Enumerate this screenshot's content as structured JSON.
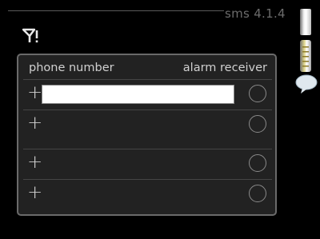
{
  "menu": {
    "label": "sms 4.1.4"
  },
  "icons": {
    "signal": "antenna-signal-icon",
    "chat": "speech-bubble-icon"
  },
  "table": {
    "headers": {
      "phone": "phone number",
      "alarm": "alarm receiver"
    },
    "rows": [
      {
        "plus": "+",
        "value": "",
        "has_input": true,
        "alarm_selected": false
      },
      {
        "plus": "+",
        "value": "",
        "has_input": false,
        "alarm_selected": false
      },
      {
        "plus": "+",
        "value": "",
        "has_input": false,
        "alarm_selected": false
      },
      {
        "plus": "+",
        "value": "",
        "has_input": false,
        "alarm_selected": false
      }
    ]
  },
  "colors": {
    "background": "#000000",
    "panel": "#222222",
    "text": "#d0d0d0",
    "muted": "#6c6c6c",
    "scroll_accent": "#e2d98f"
  }
}
